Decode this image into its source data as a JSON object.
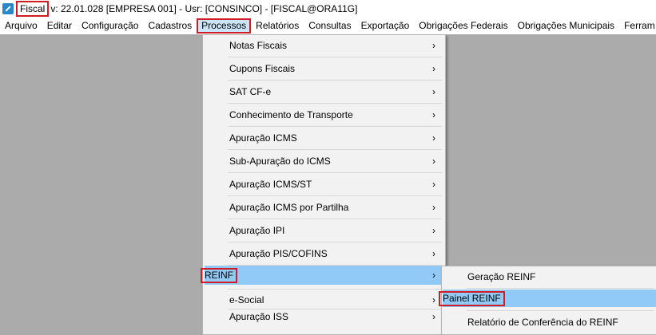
{
  "titlebar": {
    "app_name": "Fiscal",
    "info": "v: 22.01.028  [EMPRESA 001] - Usr: [CONSINCO] - [FISCAL@ORA11G]"
  },
  "menubar": {
    "items": [
      "Arquivo",
      "Editar",
      "Configuração",
      "Cadastros",
      "Processos",
      "Relatórios",
      "Consultas",
      "Exportação",
      "Obrigações Federais",
      "Obrigações Municipais",
      "Ferram"
    ],
    "active": "Processos"
  },
  "processos_menu": {
    "items": [
      {
        "label": "Notas Fiscais",
        "submenu": true
      },
      {
        "label": "Cupons Fiscais",
        "submenu": true
      },
      {
        "label": "SAT CF-e",
        "submenu": true
      },
      {
        "label": "Conhecimento de Transporte",
        "submenu": true
      },
      {
        "label": "Apuração ICMS",
        "submenu": true
      },
      {
        "label": "Sub-Apuração do ICMS",
        "submenu": true
      },
      {
        "label": "Apuração ICMS/ST",
        "submenu": true
      },
      {
        "label": "Apuração ICMS por Partilha",
        "submenu": true
      },
      {
        "label": "Apuração IPI",
        "submenu": true
      },
      {
        "label": "Apuração PIS/COFINS",
        "submenu": true
      },
      {
        "label": "REINF",
        "submenu": true
      },
      {
        "label": "e-Social",
        "submenu": true
      },
      {
        "label": "Apuração ISS",
        "submenu": true
      }
    ],
    "arrow": "›",
    "highlighted": "REINF"
  },
  "reinf_submenu": {
    "items": [
      "Geração REINF",
      "Painel REINF",
      "Relatório de Conferência do REINF"
    ],
    "highlighted": "Painel REINF"
  },
  "colors": {
    "highlight_box": "#d01c24",
    "menu_highlight": "#91c9f7",
    "workspace": "#ababab"
  }
}
